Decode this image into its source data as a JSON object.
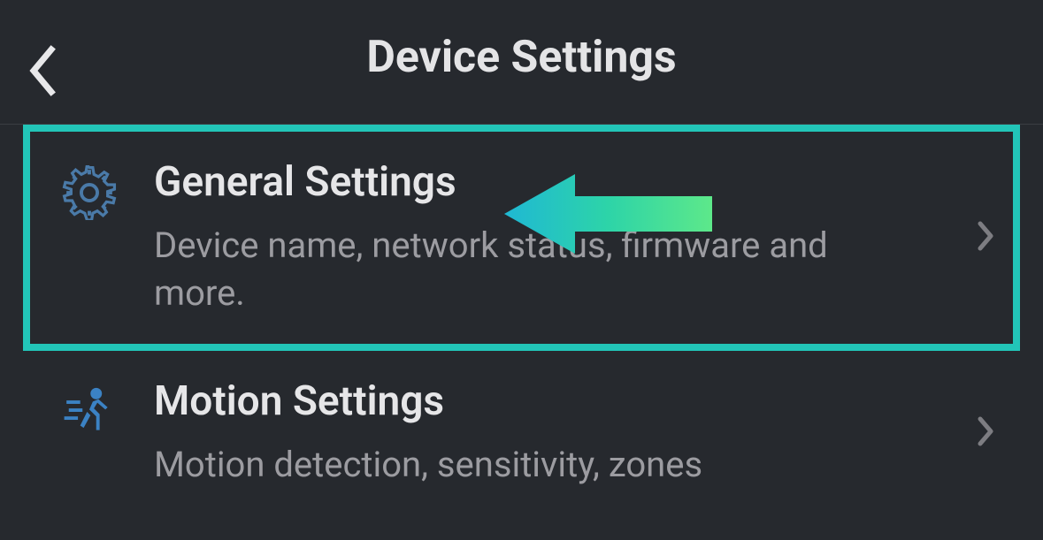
{
  "header": {
    "title": "Device Settings"
  },
  "items": [
    {
      "icon": "gear-icon",
      "title": "General Settings",
      "subtitle": "Device name, network status, firmware and more."
    },
    {
      "icon": "motion-icon",
      "title": "Motion Settings",
      "subtitle": "Motion detection, sensitivity, zones"
    }
  ]
}
